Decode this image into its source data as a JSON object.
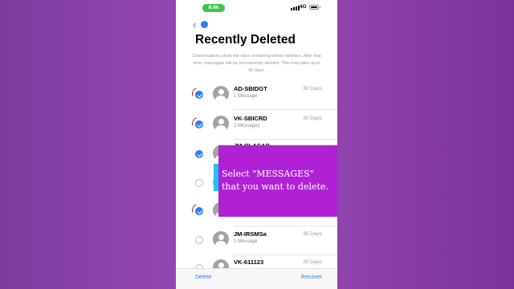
{
  "status_bar": {
    "time": "8:46",
    "network": "4G"
  },
  "nav": {
    "back_badge": ""
  },
  "page": {
    "title": "Recently Deleted",
    "info": "Conversations show the days remaining before deletion. After that time, messages will be permanently deleted. This may take up to 40 days."
  },
  "conversations": [
    {
      "name": "AD-SBIDGT",
      "detail": "1 Message",
      "days": "30 Days",
      "selected": true
    },
    {
      "name": "VK-SBICRD",
      "detail": "2 Messages",
      "days": "30 Days",
      "selected": true
    },
    {
      "name": "JM-OLACAB",
      "detail": "",
      "days": "",
      "selected": true
    },
    {
      "name": "",
      "detail": "",
      "days": "",
      "selected": false
    },
    {
      "name": "",
      "detail": "",
      "days": "",
      "selected": true
    },
    {
      "name": "JM-IRSMSa",
      "detail": "1 Message",
      "days": "30 Days",
      "selected": false
    },
    {
      "name": "VK-611123",
      "detail": "",
      "days": "30 Days",
      "selected": false
    }
  ],
  "bottom_bar": {
    "delete_label": "Delete",
    "recover_label": "Recover"
  },
  "overlay": {
    "line1": "Select \"MESSAGES\"",
    "line2": "that you want to delete."
  },
  "colors": {
    "accent": "#2f7df6",
    "overlay_bg": "#b021d6",
    "background": "#8e44ad",
    "status_pill": "#3ec44c"
  }
}
